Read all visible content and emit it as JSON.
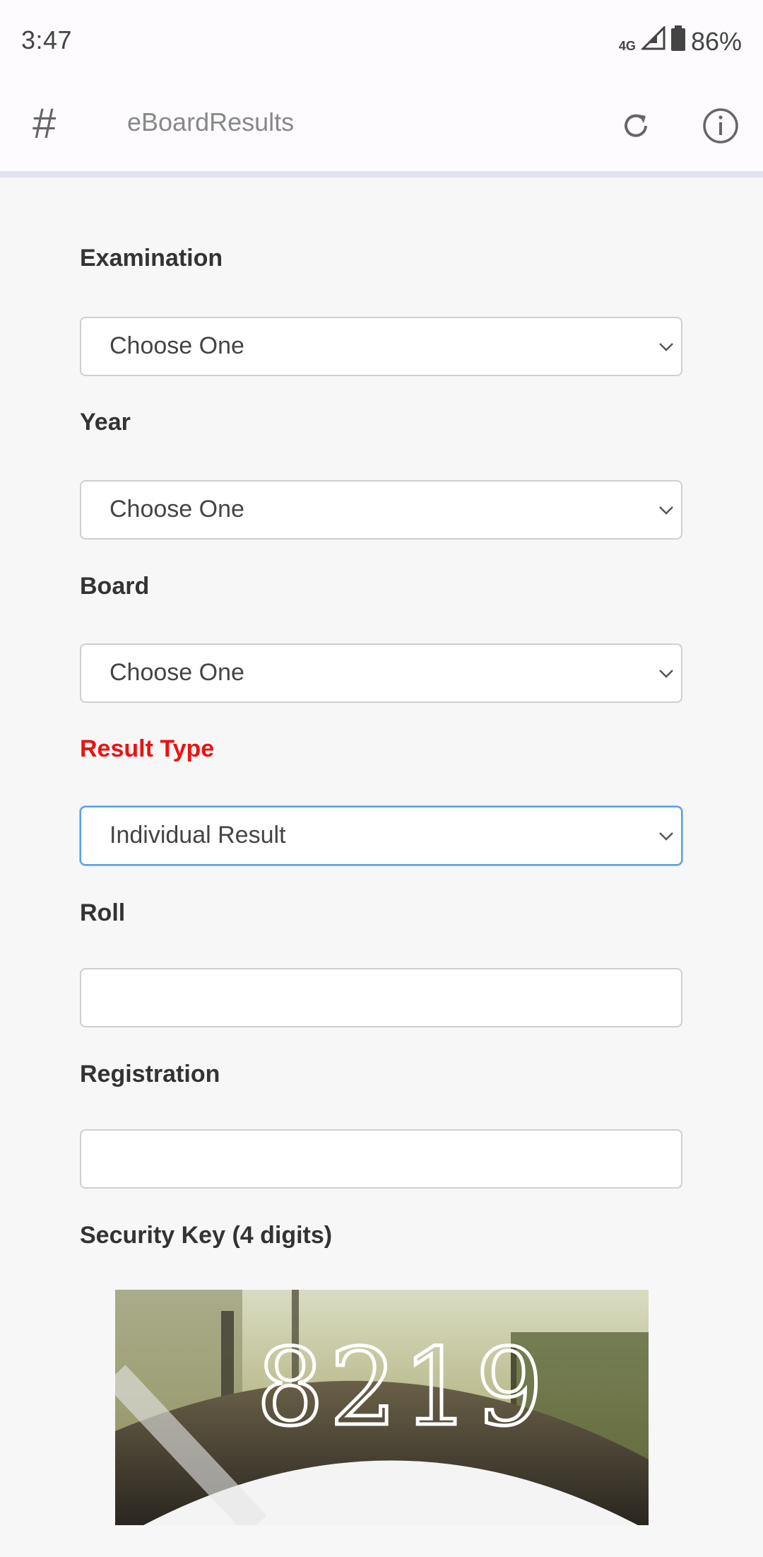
{
  "status": {
    "time": "3:47",
    "network": "4G",
    "battery": "86%"
  },
  "appbar": {
    "logo_glyph": "#",
    "title": "eBoardResults"
  },
  "form": {
    "examination": {
      "label": "Examination",
      "value": "Choose One"
    },
    "year": {
      "label": "Year",
      "value": "Choose One"
    },
    "board": {
      "label": "Board",
      "value": "Choose One"
    },
    "result_type": {
      "label": "Result Type",
      "value": "Individual Result",
      "label_color": "#ee1111"
    },
    "roll": {
      "label": "Roll",
      "value": ""
    },
    "registration": {
      "label": "Registration",
      "value": ""
    },
    "security_key": {
      "label": "Security Key (4 digits)",
      "captcha_text": "8219"
    }
  },
  "colors": {
    "accent_focus": "#5aa0e6",
    "appbar_bg": "#fdfbfe",
    "page_bg": "#f7f7f7"
  }
}
